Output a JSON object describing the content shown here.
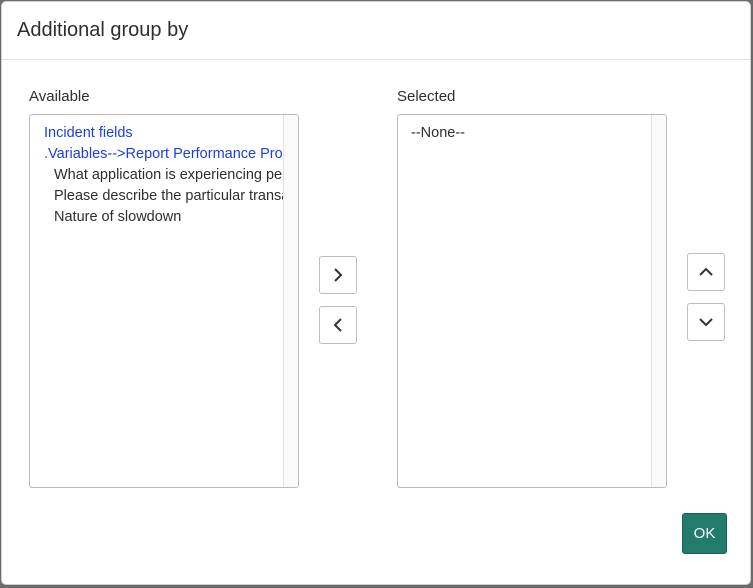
{
  "dialog": {
    "title": "Additional group by",
    "ok_label": "OK"
  },
  "available": {
    "label": "Available",
    "items": [
      {
        "text": "Incident fields",
        "kind": "group"
      },
      {
        "text": ".Variables-->Report Performance Problem",
        "kind": "group"
      },
      {
        "text": "What application is experiencing performance issues",
        "kind": "child"
      },
      {
        "text": "Please describe the particular transaction",
        "kind": "child"
      },
      {
        "text": "Nature of slowdown",
        "kind": "child"
      }
    ]
  },
  "selected": {
    "label": "Selected",
    "items": [
      {
        "text": "--None--",
        "kind": "none"
      }
    ]
  },
  "controls": {
    "add_icon": "chevron-right-icon",
    "remove_icon": "chevron-left-icon",
    "move_up_icon": "chevron-up-icon",
    "move_down_icon": "chevron-down-icon"
  },
  "colors": {
    "accent": "#237b6b",
    "group_text": "#1d3de0"
  }
}
